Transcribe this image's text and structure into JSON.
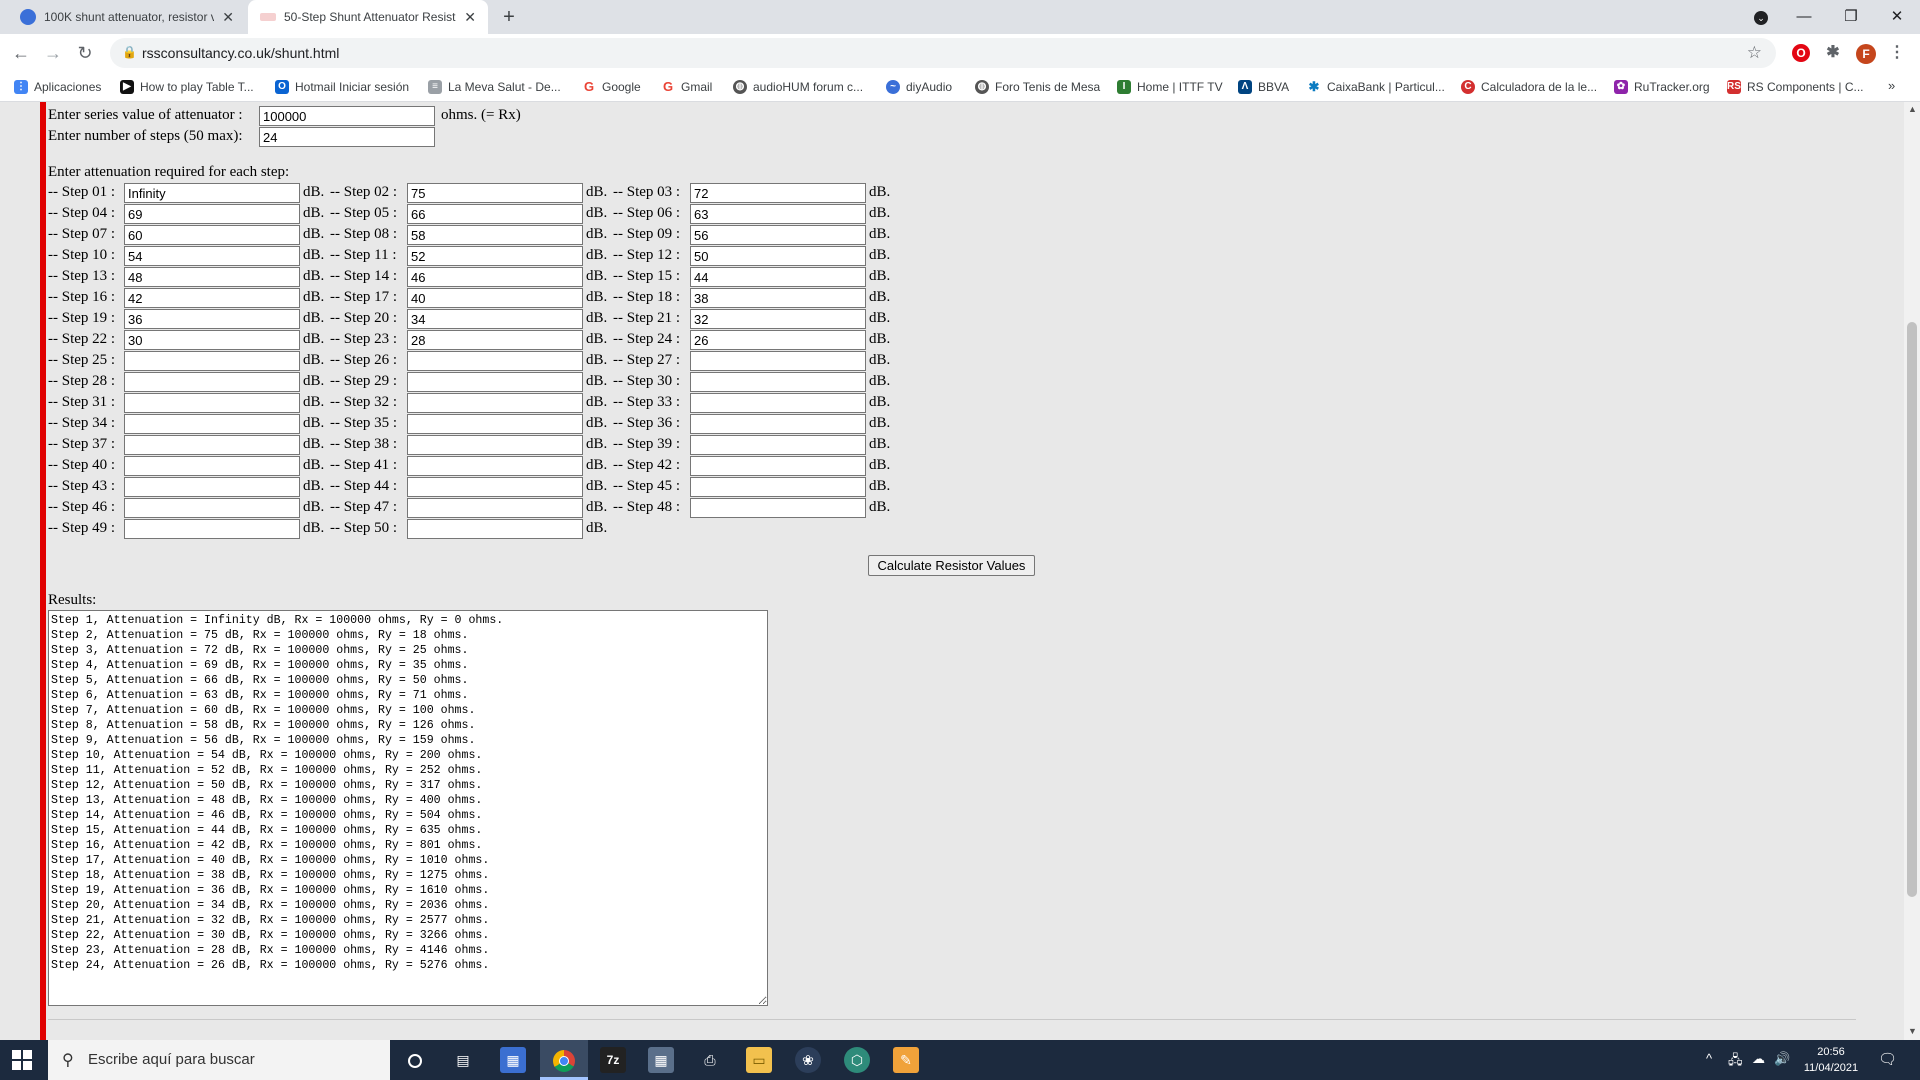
{
  "tabs": [
    {
      "title": "100K shunt attenuator, resistor v",
      "close": "✕",
      "favicon_color": "#3a6fd8",
      "active": false
    },
    {
      "title": "50-Step Shunt Attenuator Resisto",
      "close": "✕",
      "favicon_color": "#c44a4a",
      "active": true
    }
  ],
  "new_tab": "+",
  "window": {
    "minimize": "—",
    "maximize": "❐",
    "close": "✕",
    "profile_menu": "⌄"
  },
  "toolbar": {
    "back": "←",
    "forward": "→",
    "reload": "↻",
    "lock": "🔒",
    "url": "rssconsultancy.co.uk/shunt.html",
    "star": "☆",
    "menu": "⋮",
    "profile_letter": "F",
    "extensions": "✱",
    "opera": "O"
  },
  "bookmarks": [
    {
      "label": "Aplicaciones",
      "icon": "apps-grid-icon",
      "color": "#4285f4"
    },
    {
      "label": "How to play Table T...",
      "icon": "video-icon",
      "color": "#111111"
    },
    {
      "label": "Hotmail Iniciar sesión",
      "icon": "outlook-icon",
      "color": "#0a64d2"
    },
    {
      "label": "La Meva Salut - De...",
      "icon": "page-icon",
      "color": "#9aa0a6"
    },
    {
      "label": "Google",
      "icon": "google-icon",
      "color": "#ea4335"
    },
    {
      "label": "Gmail",
      "icon": "google-icon",
      "color": "#ea4335"
    },
    {
      "label": "audioHUM forum c...",
      "icon": "globe-icon",
      "color": "#555555"
    },
    {
      "label": "diyAudio",
      "icon": "wave-icon",
      "color": "#3a6fd8"
    },
    {
      "label": "Foro Tenis de Mesa",
      "icon": "globe-icon",
      "color": "#555555"
    },
    {
      "label": "Home | ITTF TV",
      "icon": "ittf-icon",
      "color": "#2e7d32"
    },
    {
      "label": "BBVA",
      "icon": "bbva-icon",
      "color": "#004481"
    },
    {
      "label": "CaixaBank | Particul...",
      "icon": "star-icon",
      "color": "#0a7bc1"
    },
    {
      "label": "Calculadora de la le...",
      "icon": "calc-icon",
      "color": "#d32f2f"
    },
    {
      "label": "RuTracker.org",
      "icon": "rutracker-icon",
      "color": "#8e24aa"
    },
    {
      "label": "RS Components | C...",
      "icon": "rs-icon",
      "color": "#d32f2f"
    }
  ],
  "bookmarks_more": "»",
  "form": {
    "series_label": "Enter series value of attenuator :",
    "series_value": "100000",
    "series_unit": "ohms. (= Rx)",
    "steps_label": "Enter number of steps (50 max):",
    "steps_value": "24",
    "attenuation_heading": "Enter attenuation required for each step:",
    "unit": "dB.",
    "steps": [
      {
        "label": "-- Step 01 :",
        "value": "Infinity"
      },
      {
        "label": "-- Step 02 :",
        "value": "75"
      },
      {
        "label": "-- Step 03 :",
        "value": "72"
      },
      {
        "label": "-- Step 04 :",
        "value": "69"
      },
      {
        "label": "-- Step 05 :",
        "value": "66"
      },
      {
        "label": "-- Step 06 :",
        "value": "63"
      },
      {
        "label": "-- Step 07 :",
        "value": "60"
      },
      {
        "label": "-- Step 08 :",
        "value": "58"
      },
      {
        "label": "-- Step 09 :",
        "value": "56"
      },
      {
        "label": "-- Step 10 :",
        "value": "54"
      },
      {
        "label": "-- Step 11 :",
        "value": "52"
      },
      {
        "label": "-- Step 12 :",
        "value": "50"
      },
      {
        "label": "-- Step 13 :",
        "value": "48"
      },
      {
        "label": "-- Step 14 :",
        "value": "46"
      },
      {
        "label": "-- Step 15 :",
        "value": "44"
      },
      {
        "label": "-- Step 16 :",
        "value": "42"
      },
      {
        "label": "-- Step 17 :",
        "value": "40"
      },
      {
        "label": "-- Step 18 :",
        "value": "38"
      },
      {
        "label": "-- Step 19 :",
        "value": "36"
      },
      {
        "label": "-- Step 20 :",
        "value": "34"
      },
      {
        "label": "-- Step 21 :",
        "value": "32"
      },
      {
        "label": "-- Step 22 :",
        "value": "30"
      },
      {
        "label": "-- Step 23 :",
        "value": "28"
      },
      {
        "label": "-- Step 24 :",
        "value": "26"
      },
      {
        "label": "-- Step 25 :",
        "value": ""
      },
      {
        "label": "-- Step 26 :",
        "value": ""
      },
      {
        "label": "-- Step 27 :",
        "value": ""
      },
      {
        "label": "-- Step 28 :",
        "value": ""
      },
      {
        "label": "-- Step 29 :",
        "value": ""
      },
      {
        "label": "-- Step 30 :",
        "value": ""
      },
      {
        "label": "-- Step 31 :",
        "value": ""
      },
      {
        "label": "-- Step 32 :",
        "value": ""
      },
      {
        "label": "-- Step 33 :",
        "value": ""
      },
      {
        "label": "-- Step 34 :",
        "value": ""
      },
      {
        "label": "-- Step 35 :",
        "value": ""
      },
      {
        "label": "-- Step 36 :",
        "value": ""
      },
      {
        "label": "-- Step 37 :",
        "value": ""
      },
      {
        "label": "-- Step 38 :",
        "value": ""
      },
      {
        "label": "-- Step 39 :",
        "value": ""
      },
      {
        "label": "-- Step 40 :",
        "value": ""
      },
      {
        "label": "-- Step 41 :",
        "value": ""
      },
      {
        "label": "-- Step 42 :",
        "value": ""
      },
      {
        "label": "-- Step 43 :",
        "value": ""
      },
      {
        "label": "-- Step 44 :",
        "value": ""
      },
      {
        "label": "-- Step 45 :",
        "value": ""
      },
      {
        "label": "-- Step 46 :",
        "value": ""
      },
      {
        "label": "-- Step 47 :",
        "value": ""
      },
      {
        "label": "-- Step 48 :",
        "value": ""
      },
      {
        "label": "-- Step 49 :",
        "value": ""
      },
      {
        "label": "-- Step 50 :",
        "value": ""
      }
    ],
    "calculate_label": "Calculate Resistor Values",
    "results_label": "Results:",
    "results": [
      "Step 1, Attenuation = Infinity dB, Rx = 100000 ohms, Ry = 0 ohms.",
      "Step 2, Attenuation = 75 dB, Rx = 100000 ohms, Ry = 18 ohms.",
      "Step 3, Attenuation = 72 dB, Rx = 100000 ohms, Ry = 25 ohms.",
      "Step 4, Attenuation = 69 dB, Rx = 100000 ohms, Ry = 35 ohms.",
      "Step 5, Attenuation = 66 dB, Rx = 100000 ohms, Ry = 50 ohms.",
      "Step 6, Attenuation = 63 dB, Rx = 100000 ohms, Ry = 71 ohms.",
      "Step 7, Attenuation = 60 dB, Rx = 100000 ohms, Ry = 100 ohms.",
      "Step 8, Attenuation = 58 dB, Rx = 100000 ohms, Ry = 126 ohms.",
      "Step 9, Attenuation = 56 dB, Rx = 100000 ohms, Ry = 159 ohms.",
      "Step 10, Attenuation = 54 dB, Rx = 100000 ohms, Ry = 200 ohms.",
      "Step 11, Attenuation = 52 dB, Rx = 100000 ohms, Ry = 252 ohms.",
      "Step 12, Attenuation = 50 dB, Rx = 100000 ohms, Ry = 317 ohms.",
      "Step 13, Attenuation = 48 dB, Rx = 100000 ohms, Ry = 400 ohms.",
      "Step 14, Attenuation = 46 dB, Rx = 100000 ohms, Ry = 504 ohms.",
      "Step 15, Attenuation = 44 dB, Rx = 100000 ohms, Ry = 635 ohms.",
      "Step 16, Attenuation = 42 dB, Rx = 100000 ohms, Ry = 801 ohms.",
      "Step 17, Attenuation = 40 dB, Rx = 100000 ohms, Ry = 1010 ohms.",
      "Step 18, Attenuation = 38 dB, Rx = 100000 ohms, Ry = 1275 ohms.",
      "Step 19, Attenuation = 36 dB, Rx = 100000 ohms, Ry = 1610 ohms.",
      "Step 20, Attenuation = 34 dB, Rx = 100000 ohms, Ry = 2036 ohms.",
      "Step 21, Attenuation = 32 dB, Rx = 100000 ohms, Ry = 2577 ohms.",
      "Step 22, Attenuation = 30 dB, Rx = 100000 ohms, Ry = 3266 ohms.",
      "Step 23, Attenuation = 28 dB, Rx = 100000 ohms, Ry = 4146 ohms.",
      "Step 24, Attenuation = 26 dB, Rx = 100000 ohms, Ry = 5276 ohms."
    ]
  },
  "taskbar": {
    "search_placeholder": "Escribe aquí para buscar",
    "time": "20:56",
    "date": "11/04/2021",
    "apps": [
      "cortana-icon",
      "task-view-icon",
      "store-icon",
      "chrome-icon",
      "7zip-icon",
      "calculator-icon",
      "printer-icon",
      "file-explorer-icon",
      "paw-icon",
      "vpn-icon",
      "notepad-icon"
    ],
    "seven_zip": "7z",
    "tray": {
      "chevron": "^",
      "network": "🖧",
      "cloud": "☁",
      "volume": "🔊",
      "notifications": "🗨"
    }
  },
  "accent": {
    "page_bar": "#e00000",
    "taskbar_bg": "#1c2a3e"
  }
}
